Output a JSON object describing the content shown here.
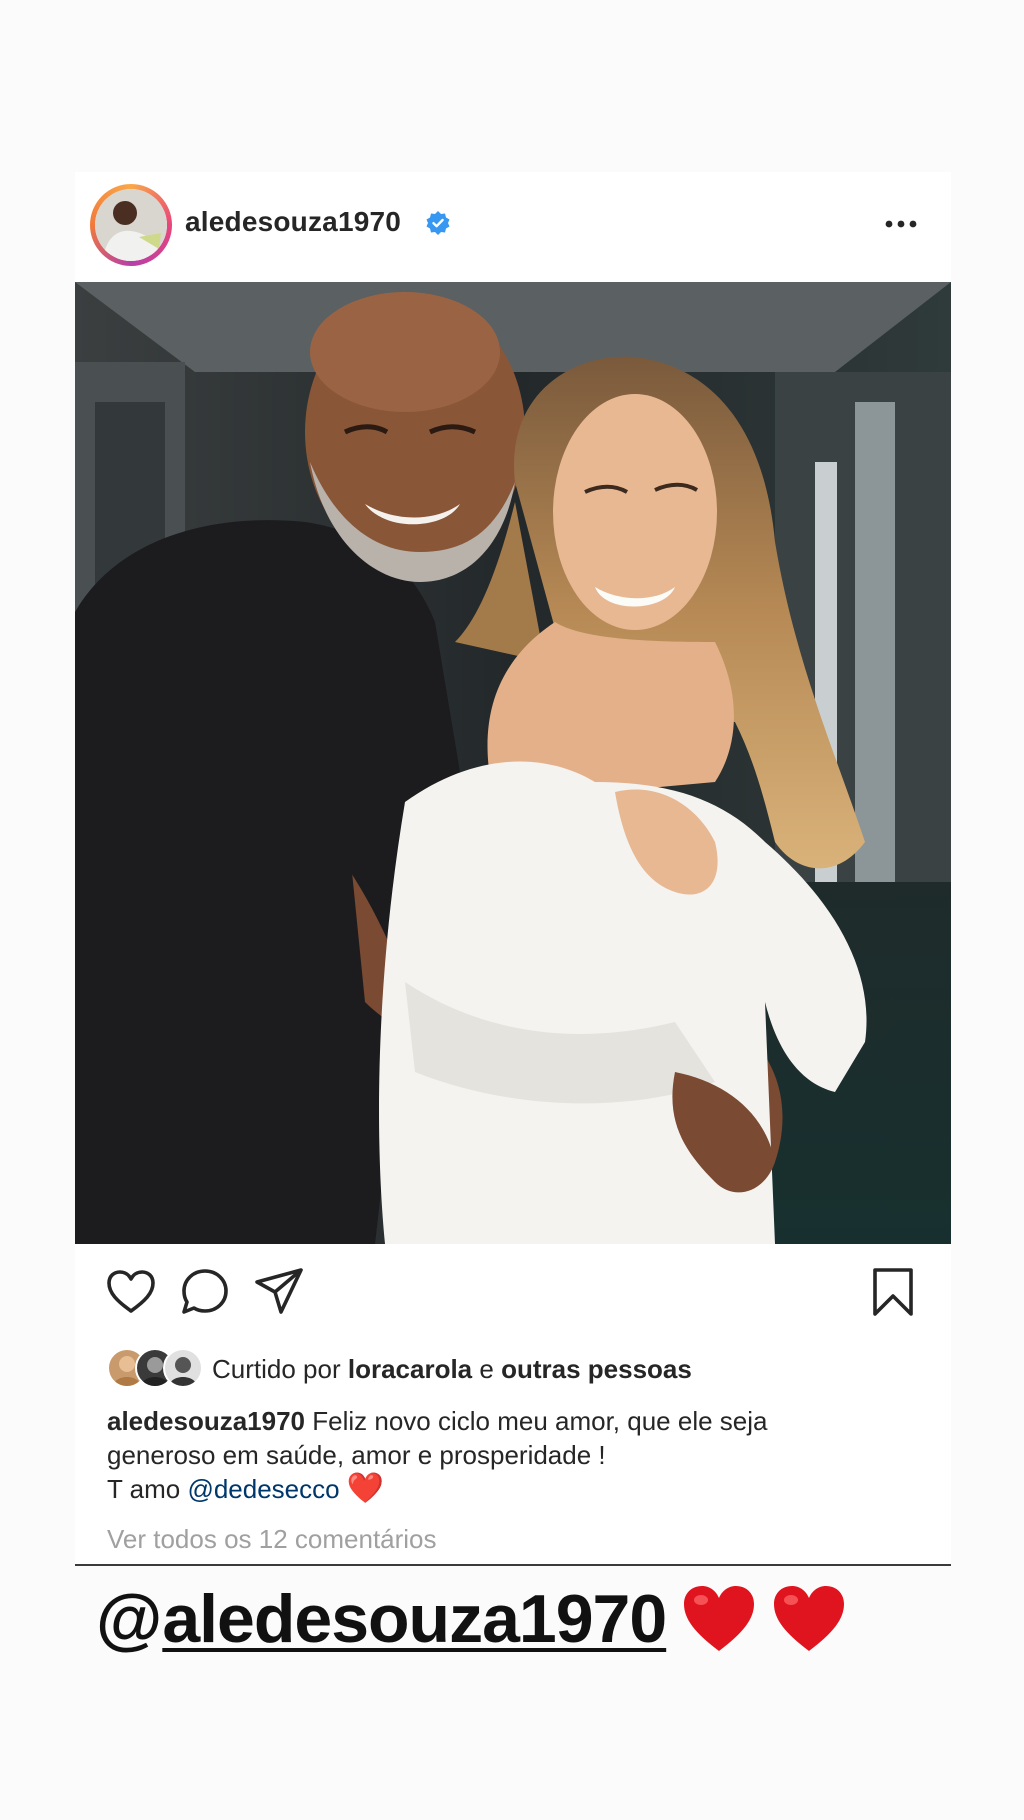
{
  "post": {
    "username": "aledesouza1970",
    "verified_icon": "verified-badge-icon",
    "more_icon": "more-options-icon",
    "photo_description_icon": "photo",
    "actions": {
      "like_icon": "heart-icon",
      "comment_icon": "comment-icon",
      "share_icon": "send-icon",
      "save_icon": "bookmark-icon"
    },
    "likes": {
      "prefix": "Curtido por",
      "user": "loracarola",
      "conjunction": "e",
      "others": "outras pessoas"
    },
    "caption": {
      "username": "aledesouza1970",
      "line1": "Feliz novo ciclo meu amor, que ele seja",
      "line2": "generoso em saúde, amor e prosperidade !",
      "line3_prefix": "T amo",
      "mention": "@dedesecco",
      "emoji": "❤️"
    },
    "view_comments": "Ver todos os 12 comentários"
  },
  "story_overlay": {
    "at": "@",
    "mention": "aledesouza1970",
    "hearts": [
      "❤️",
      "❤️"
    ]
  },
  "colors": {
    "background": "#fbfbfb",
    "verified_blue": "#3897f0",
    "mention_blue": "#00376b",
    "heart_red": "#e0141e",
    "muted_text": "#a0a0a0"
  }
}
